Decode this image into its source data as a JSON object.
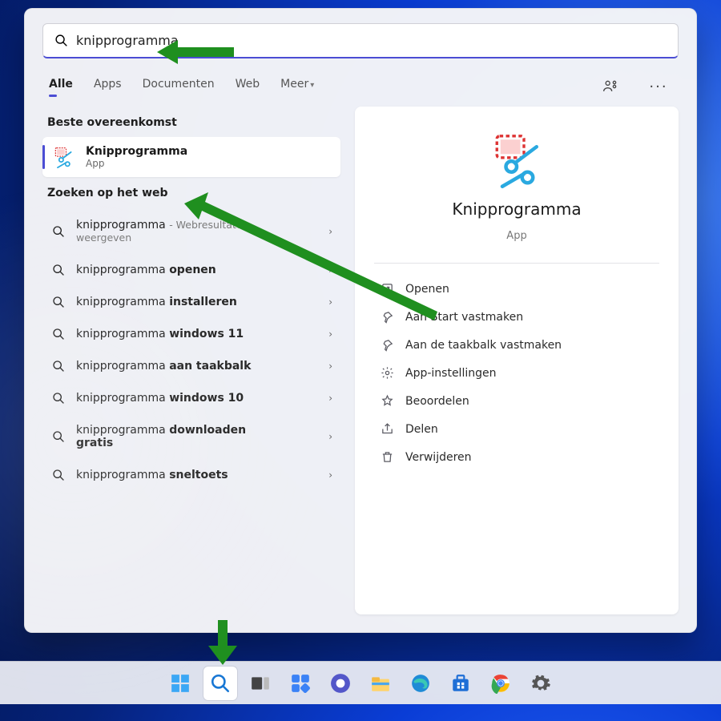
{
  "search": {
    "value": "knipprogramma"
  },
  "tabs": {
    "items": [
      "Alle",
      "Apps",
      "Documenten",
      "Web",
      "Meer"
    ],
    "active_index": 0
  },
  "sections": {
    "best_match_heading": "Beste overeenkomst",
    "web_heading": "Zoeken op het web"
  },
  "best_match": {
    "title": "Knipprogramma",
    "subtitle": "App"
  },
  "web_results": [
    {
      "prefix": "knipprogramma",
      "bold": "",
      "suffix_note": "Webresultaten weergeven"
    },
    {
      "prefix": "knipprogramma ",
      "bold": "openen",
      "suffix_note": ""
    },
    {
      "prefix": "knipprogramma ",
      "bold": "installeren",
      "suffix_note": ""
    },
    {
      "prefix": "knipprogramma ",
      "bold": "windows 11",
      "suffix_note": ""
    },
    {
      "prefix": "knipprogramma ",
      "bold": "aan taakbalk",
      "suffix_note": ""
    },
    {
      "prefix": "knipprogramma ",
      "bold": "windows 10",
      "suffix_note": ""
    },
    {
      "prefix": "knipprogramma ",
      "bold": "downloaden gratis",
      "suffix_note": ""
    },
    {
      "prefix": "knipprogramma ",
      "bold": "sneltoets",
      "suffix_note": ""
    }
  ],
  "preview": {
    "title": "Knipprogramma",
    "subtitle": "App"
  },
  "actions": [
    {
      "icon": "open",
      "label": "Openen"
    },
    {
      "icon": "pin",
      "label": "Aan Start vastmaken"
    },
    {
      "icon": "pin",
      "label": "Aan de taakbalk vastmaken"
    },
    {
      "icon": "settings",
      "label": "App-instellingen"
    },
    {
      "icon": "star",
      "label": "Beoordelen"
    },
    {
      "icon": "share",
      "label": "Delen"
    },
    {
      "icon": "trash",
      "label": "Verwijderen"
    }
  ],
  "taskbar": [
    {
      "name": "start",
      "active": false
    },
    {
      "name": "search",
      "active": true
    },
    {
      "name": "taskview",
      "active": false
    },
    {
      "name": "widgets",
      "active": false
    },
    {
      "name": "teams",
      "active": false
    },
    {
      "name": "explorer",
      "active": false
    },
    {
      "name": "edge",
      "active": false
    },
    {
      "name": "store",
      "active": false
    },
    {
      "name": "chrome",
      "active": false
    },
    {
      "name": "settings",
      "active": false
    }
  ],
  "colors": {
    "accent": "#4b4dd4",
    "arrow": "#1f8f1f"
  }
}
